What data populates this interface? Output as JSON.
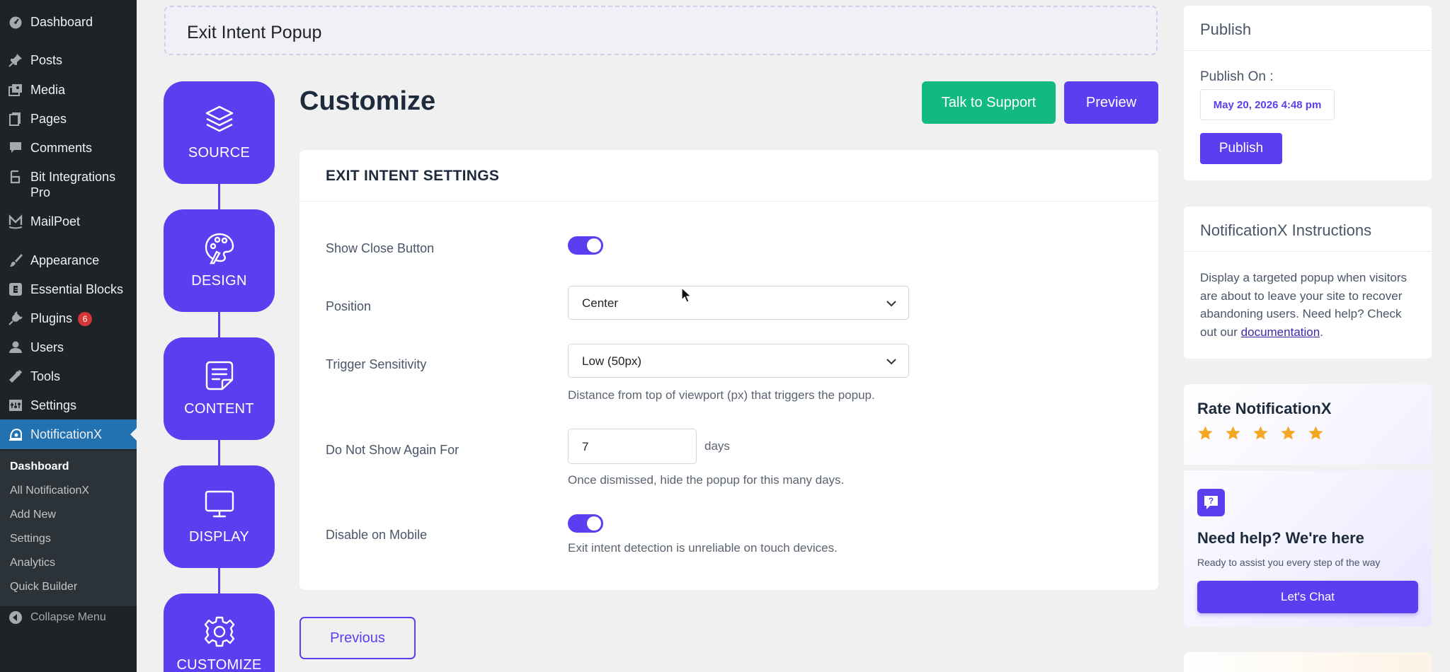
{
  "sidebar": {
    "items": [
      {
        "label": "Dashboard",
        "icon": "dashboard-icon"
      },
      {
        "label": "Posts",
        "icon": "pin-icon"
      },
      {
        "label": "Media",
        "icon": "media-icon"
      },
      {
        "label": "Pages",
        "icon": "pages-icon"
      },
      {
        "label": "Comments",
        "icon": "comment-icon"
      },
      {
        "label": "Bit Integrations Pro",
        "icon": "bit-integrations-icon"
      },
      {
        "label": "MailPoet",
        "icon": "mailpoet-icon"
      },
      {
        "label": "Appearance",
        "icon": "brush-icon"
      },
      {
        "label": "Essential Blocks",
        "icon": "essential-blocks-icon"
      },
      {
        "label": "Plugins",
        "icon": "plug-icon",
        "badge": "6"
      },
      {
        "label": "Users",
        "icon": "user-icon"
      },
      {
        "label": "Tools",
        "icon": "wrench-icon"
      },
      {
        "label": "Settings",
        "icon": "settings-icon"
      },
      {
        "label": "NotificationX",
        "icon": "notificationx-icon"
      }
    ],
    "submenu": [
      "Dashboard",
      "All NotificationX",
      "Add New",
      "Settings",
      "Analytics",
      "Quick Builder"
    ],
    "collapse_label": "Collapse Menu"
  },
  "title_box": {
    "value": "Exit Intent Popup"
  },
  "steps": [
    {
      "label": "SOURCE",
      "icon": "layers-icon"
    },
    {
      "label": "DESIGN",
      "icon": "palette-icon"
    },
    {
      "label": "CONTENT",
      "icon": "note-icon"
    },
    {
      "label": "DISPLAY",
      "icon": "monitor-icon"
    },
    {
      "label": "CUSTOMIZE",
      "icon": "gear-icon"
    }
  ],
  "main": {
    "title": "Customize",
    "support_label": "Talk to Support",
    "preview_label": "Preview",
    "previous_label": "Previous"
  },
  "settings": {
    "heading": "EXIT INTENT SETTINGS",
    "show_close_label": "Show Close Button",
    "show_close_on": true,
    "position_label": "Position",
    "position_value": "Center",
    "sensitivity_label": "Trigger Sensitivity",
    "sensitivity_value": "Low (50px)",
    "sensitivity_help": "Distance from top of viewport (px) that triggers the popup.",
    "do_not_show_label": "Do Not Show Again For",
    "do_not_show_value": "7",
    "do_not_show_unit": "days",
    "do_not_show_help": "Once dismissed, hide the popup for this many days.",
    "disable_mobile_label": "Disable on Mobile",
    "disable_mobile_on": true,
    "disable_mobile_help": "Exit intent detection is unreliable on touch devices."
  },
  "publish": {
    "heading": "Publish",
    "publish_on_label": "Publish On :",
    "date": "May 20, 2026 4:48 pm",
    "button_label": "Publish"
  },
  "instructions": {
    "heading": "NotificationX Instructions",
    "text_before": "Display a targeted popup when visitors are about to leave your site to recover abandoning users. Need help? Check out our ",
    "link_text": "documentation",
    "text_after": "."
  },
  "rate": {
    "title": "Rate NotificationX",
    "stars": 5,
    "help_title": "Need help? We're here",
    "help_sub": "Ready to assist you every step of the way",
    "chat_label": "Let's Chat"
  },
  "colors": {
    "brand": "#5a3ff0",
    "success": "#12b981",
    "wp_sidebar": "#1d2327",
    "wp_active": "#2271b1",
    "star": "#f5a623"
  }
}
